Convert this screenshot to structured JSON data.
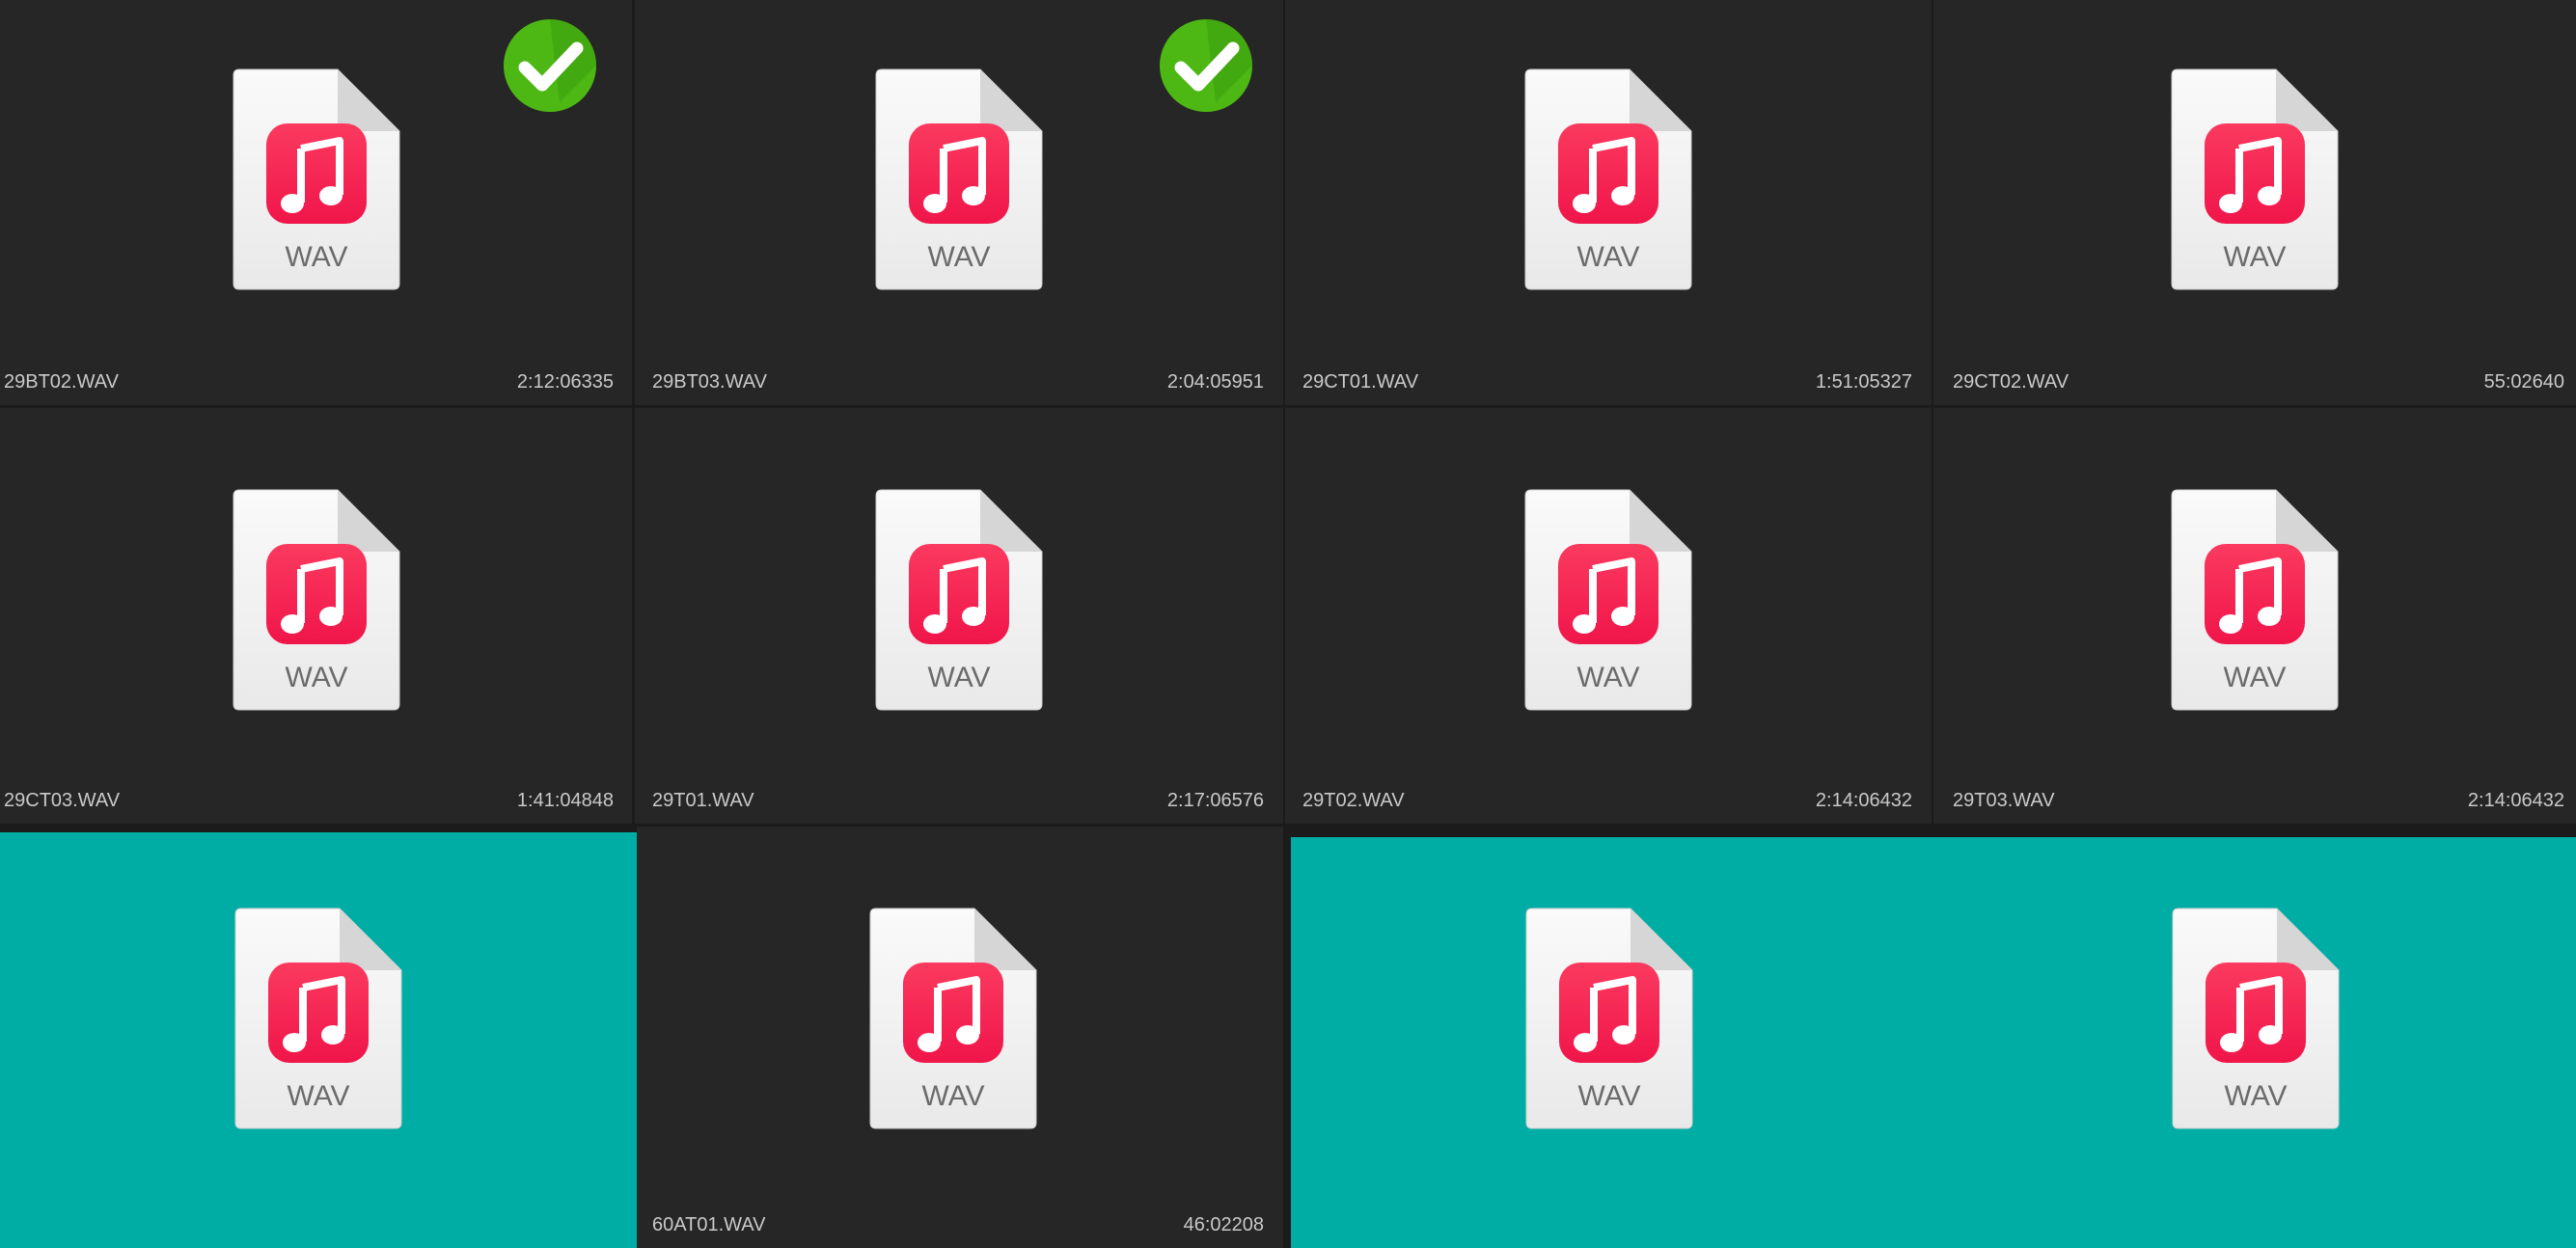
{
  "file_type_label": "WAV",
  "colors": {
    "tile_bg": "#262626",
    "selected_bg": "#00ada5",
    "music_icon_red": "#f0154a",
    "check_green": "#4db814"
  },
  "icons": {
    "file": "audio-file-icon",
    "note": "music-note-icon",
    "check": "checkmark-badge-icon"
  },
  "files": [
    {
      "name": "29BT02.WAV",
      "duration": "2:12:06335",
      "checked": true,
      "selected": false
    },
    {
      "name": "29BT03.WAV",
      "duration": "2:04:05951",
      "checked": true,
      "selected": false
    },
    {
      "name": "29CT01.WAV",
      "duration": "1:51:05327",
      "checked": false,
      "selected": false
    },
    {
      "name": "29CT02.WAV",
      "duration": "55:02640",
      "checked": false,
      "selected": false
    },
    {
      "name": "29CT03.WAV",
      "duration": "1:41:04848",
      "checked": false,
      "selected": false
    },
    {
      "name": "29T01.WAV",
      "duration": "2:17:06576",
      "checked": false,
      "selected": false
    },
    {
      "name": "29T02.WAV",
      "duration": "2:14:06432",
      "checked": false,
      "selected": false
    },
    {
      "name": "29T03.WAV",
      "duration": "2:14:06432",
      "checked": false,
      "selected": false
    },
    {
      "name": "",
      "duration": "",
      "checked": false,
      "selected": true
    },
    {
      "name": "60AT01.WAV",
      "duration": "46:02208",
      "checked": false,
      "selected": false
    },
    {
      "name": "",
      "duration": "",
      "checked": false,
      "selected": true
    },
    {
      "name": "",
      "duration": "",
      "checked": false,
      "selected": true
    }
  ]
}
